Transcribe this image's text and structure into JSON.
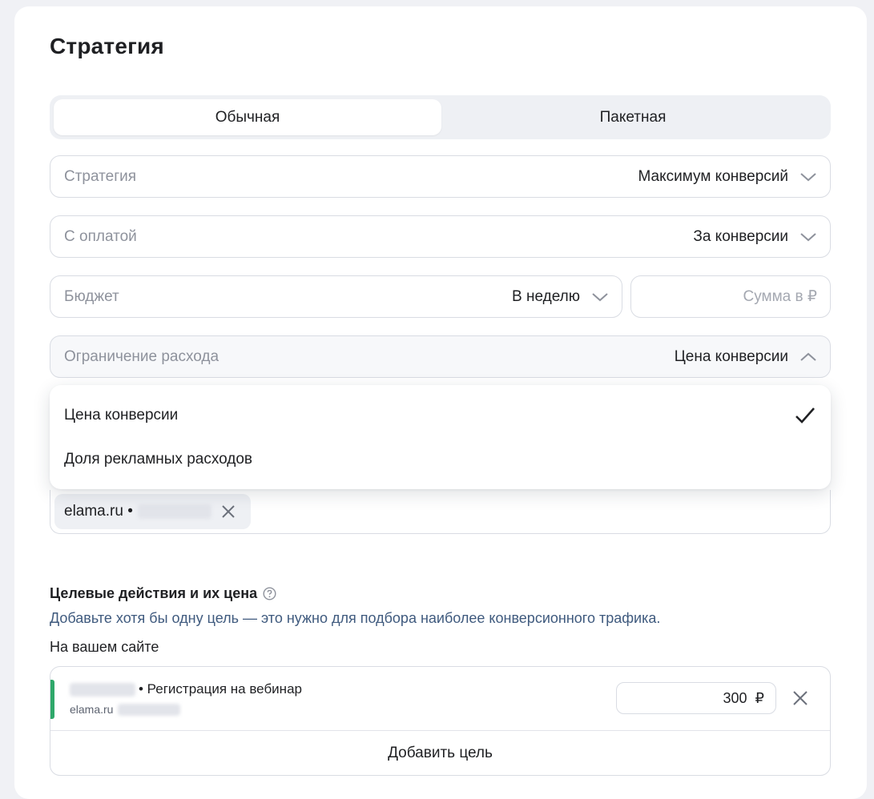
{
  "title": "Стратегия",
  "segmented": {
    "active": "Обычная",
    "inactive": "Пакетная"
  },
  "fields": {
    "strategy": {
      "label": "Стратегия",
      "value": "Максимум конверсий"
    },
    "payment": {
      "label": "С оплатой",
      "value": "За конверсии"
    },
    "budget": {
      "label": "Бюджет",
      "value": "В неделю"
    },
    "amount": {
      "placeholder": "Сумма в ₽"
    },
    "limit": {
      "label": "Ограничение расхода",
      "value": "Цена конверсии"
    }
  },
  "dropdown": {
    "options": [
      "Цена конверсии",
      "Доля рекламных расходов"
    ],
    "selected_index": 0
  },
  "counter_chip": {
    "text": "elama.ru •"
  },
  "goals_section": {
    "title": "Целевые действия и их цена",
    "description": "Добавьте хотя бы одну цель — это нужно для подбора наиболее конверсионного трафика.",
    "subtitle": "На вашем сайте",
    "goal": {
      "name": "• Регистрация на вебинар",
      "site": "elama.ru",
      "price": "300",
      "currency": "₽",
      "accent_color": "#2ea86a"
    },
    "add_label": "Добавить цель"
  },
  "icons": {
    "chevron": "chevron-down-icon",
    "chevron_up": "chevron-up-icon",
    "check": "check-icon",
    "close": "close-icon",
    "help": "help-circle-icon"
  }
}
